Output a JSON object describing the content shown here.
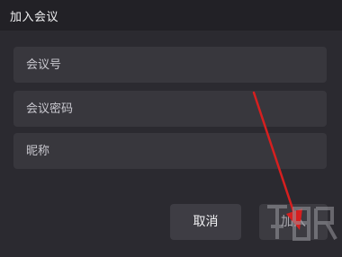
{
  "dialog": {
    "title": "加入会议"
  },
  "fields": {
    "meeting_id_placeholder": "会议号",
    "meeting_password_placeholder": "会议密码",
    "nickname_placeholder": "昵称"
  },
  "buttons": {
    "cancel_label": "取消",
    "join_label": "加入"
  },
  "colors": {
    "background": "#2b2a30",
    "title_bar": "#222126",
    "field_bg": "#38373d",
    "annotation_arrow": "#d61f1f"
  }
}
